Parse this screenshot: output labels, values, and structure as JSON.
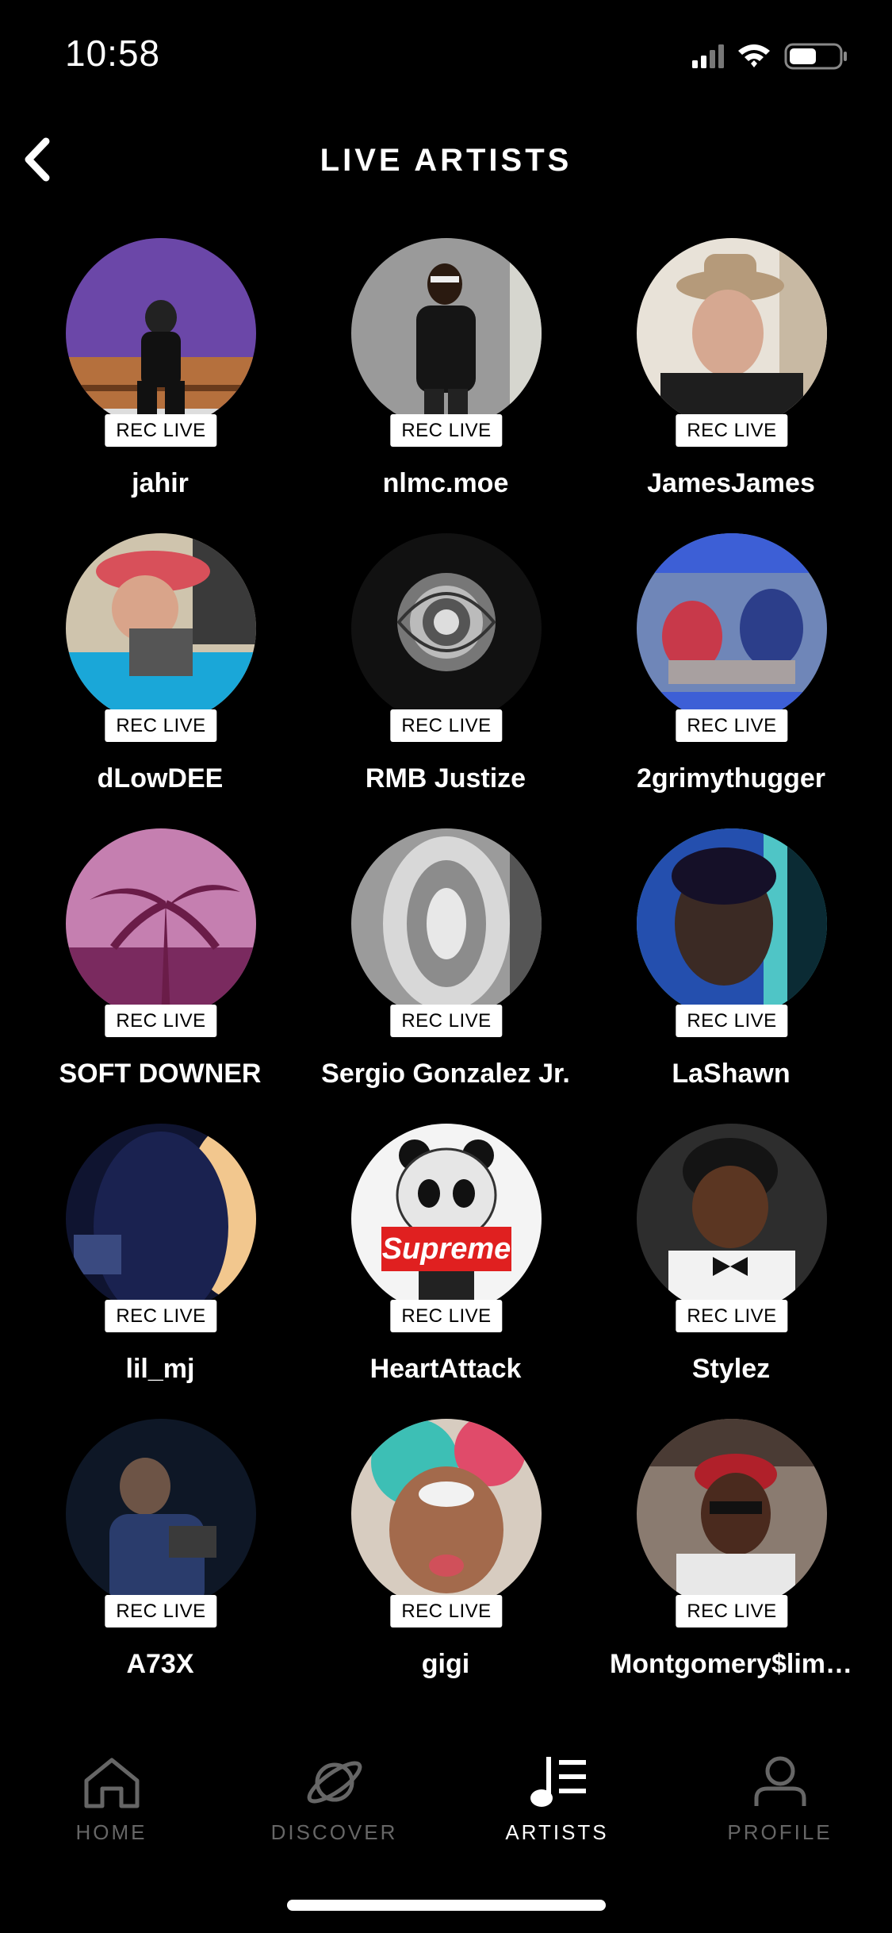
{
  "status_bar": {
    "time": "10:58"
  },
  "header": {
    "title": "LIVE ARTISTS"
  },
  "badge_label": "REC LIVE",
  "artists": [
    {
      "name": "jahir",
      "avatar": "person-on-bench-purple-wall"
    },
    {
      "name": "nlmc.moe",
      "avatar": "person-black-shirt"
    },
    {
      "name": "JamesJames",
      "avatar": "man-in-hat"
    },
    {
      "name": "dLowDEE",
      "avatar": "man-red-cap-blue-shirt"
    },
    {
      "name": "RMB Justize",
      "avatar": "black-white-rose"
    },
    {
      "name": "2grimythugger",
      "avatar": "kids-text-graphic"
    },
    {
      "name": "SOFT DOWNER",
      "avatar": "palm-trees-pink"
    },
    {
      "name": "Sergio Gonzalez Jr.",
      "avatar": "silver-ring"
    },
    {
      "name": "LaShawn",
      "avatar": "young-man-teal"
    },
    {
      "name": "lil_mj",
      "avatar": "dark-silhouette"
    },
    {
      "name": "HeartAttack",
      "avatar": "panda-supreme"
    },
    {
      "name": "Stylez",
      "avatar": "boy-bow-tie"
    },
    {
      "name": "A73X",
      "avatar": "man-jacket-dark"
    },
    {
      "name": "gigi",
      "avatar": "girl-selfie-teal"
    },
    {
      "name": "Montgomery$lim…",
      "avatar": "man-red-cap-sunglasses"
    }
  ],
  "supreme_text": "Supreme",
  "tabs": [
    {
      "label": "HOME",
      "icon": "home-icon",
      "active": false
    },
    {
      "label": "DISCOVER",
      "icon": "planet-icon",
      "active": false
    },
    {
      "label": "ARTISTS",
      "icon": "music-list-icon",
      "active": true
    },
    {
      "label": "PROFILE",
      "icon": "person-icon",
      "active": false
    }
  ]
}
